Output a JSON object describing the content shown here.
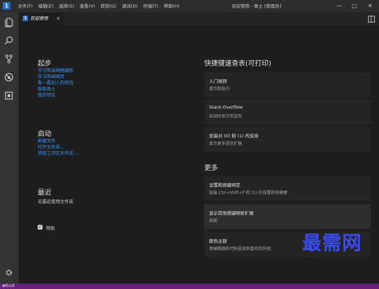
{
  "titlebar": {
    "menu": [
      "文件(F)",
      "编辑(E)",
      "选择(S)",
      "查看(V)",
      "转到(G)",
      "调试(D)",
      "终端(T)",
      "帮助(H)"
    ],
    "window_title": "欢迎使用 - 勇士 [管理员]",
    "logo": "1",
    "controls": {
      "minimize": "—",
      "maximize": "□",
      "close": "✕"
    }
  },
  "activitybar": {
    "icons": [
      "explorer-icon",
      "search-icon",
      "source-control-icon",
      "debug-icon",
      "extensions-icon",
      "settings-gear-icon"
    ]
  },
  "tabs": [
    {
      "label": "欢迎使用",
      "close": "×"
    }
  ],
  "welcome": {
    "start": {
      "title": "起步",
      "links": [
        "学习简单网络编程",
        "学习简单网页",
        "看一看别人的项目",
        "探索勇士",
        "我的项目"
      ]
    },
    "launch": {
      "title": "启动",
      "links": [
        "新建文件",
        "打开文件夹...",
        "添加工作区文件夹..."
      ]
    },
    "recent": {
      "title": "最近",
      "empty": "无最近使用文件夹"
    },
    "help_checkbox": "帮助",
    "shortcuts": {
      "title": "快捷键速查表(可打印)",
      "cards": [
        {
          "title": "入门视频",
          "sub": "提示和技巧"
        },
        {
          "title": "Stack Overflow",
          "sub": "启动时显示欢迎页"
        },
        {
          "title": "安装对 (0) 和 (1) 的支持",
          "sub": "显示更多语言扩展"
        }
      ]
    },
    "more": {
      "title": "更多",
      "cards": [
        {
          "title": "设置和按键绑定",
          "sub": "安装 Ctrl+Shift+P 和 (1) 的设置和快捷键"
        },
        {
          "title": "显示其他按键映射扩展",
          "sub": "其他"
        },
        {
          "title": "颜色主题",
          "sub": "使编辑器和代码呈现你喜欢的外观"
        }
      ]
    }
  },
  "watermark": "最需网",
  "statusbar": {
    "text": "⊗0⚠0"
  },
  "colors": {
    "accent": "#3794ff",
    "status_bar": "#68217a",
    "background": "#1e1e1e"
  }
}
